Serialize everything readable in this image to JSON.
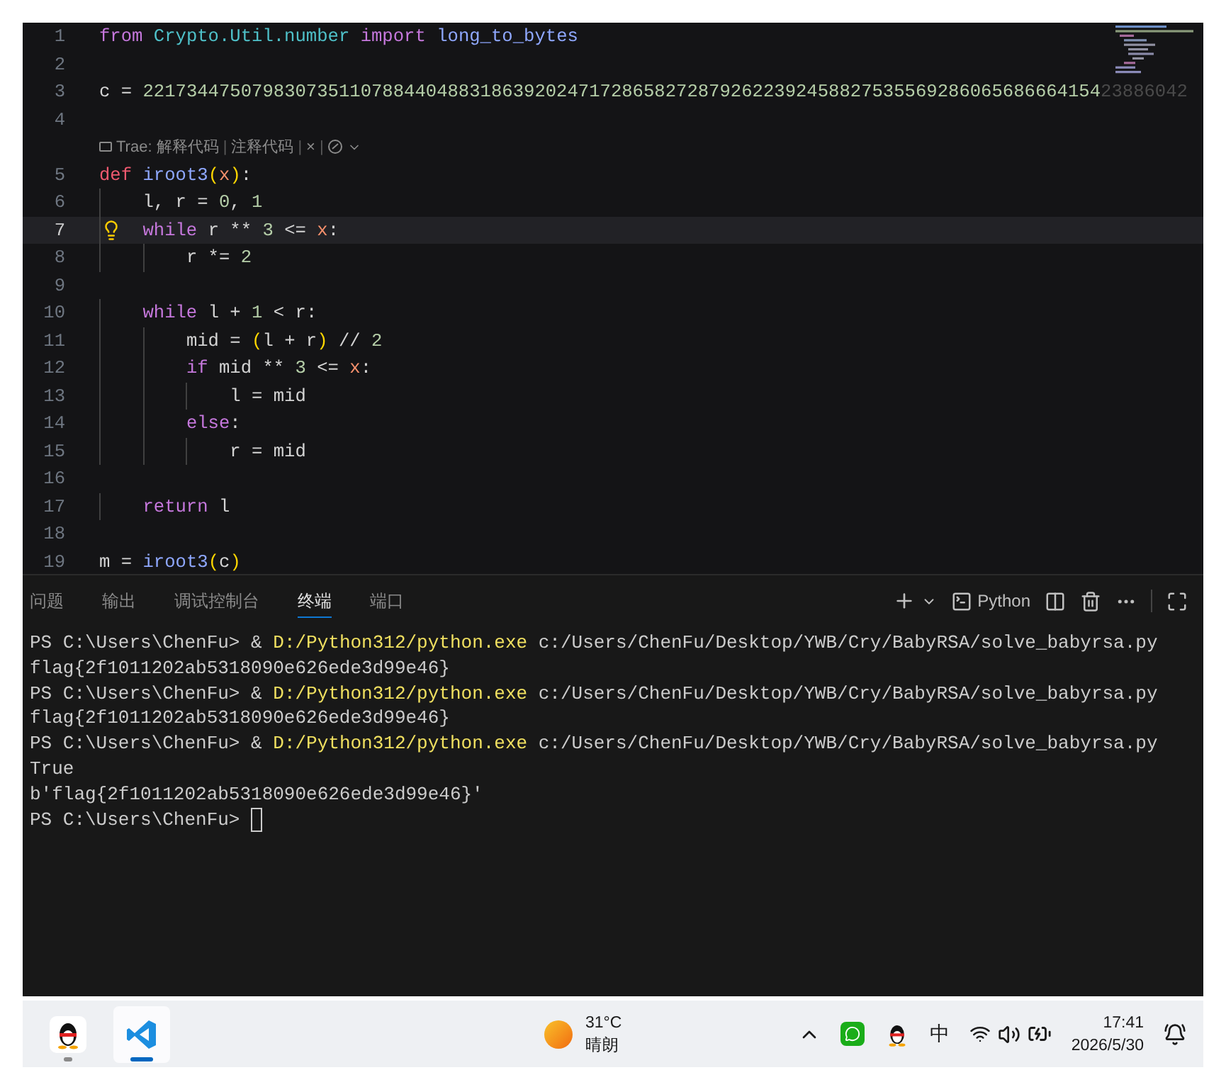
{
  "editor": {
    "lines": [
      {
        "kind": "code",
        "number": "1",
        "current": false,
        "tokens": [
          {
            "text": "from ",
            "kind": "kw"
          },
          {
            "text": "Crypto.Util.number ",
            "kind": "mod"
          },
          {
            "text": "import ",
            "kind": "kw"
          },
          {
            "text": "long_to_bytes",
            "kind": "fn"
          }
        ]
      },
      {
        "kind": "code",
        "number": "2",
        "current": false
      },
      {
        "kind": "code",
        "number": "3",
        "current": false,
        "tokens": [
          {
            "text": "c = ",
            "kind": "plain"
          },
          {
            "text": "2217344750798307351107884404883186392024717286582728792622392458827535569286065686664154",
            "kind": "num"
          },
          {
            "text": "23886042",
            "kind": "faded"
          }
        ]
      },
      {
        "kind": "code",
        "number": "4",
        "current": false
      },
      {
        "kind": "codelens",
        "segments": [
          {
            "text": "Trae: 解释代码",
            "kind": "action"
          },
          {
            "text": "|",
            "kind": "sep"
          },
          {
            "text": "注释代码",
            "kind": "action"
          },
          {
            "text": "|",
            "kind": "sep"
          },
          {
            "text": "×",
            "kind": "action"
          },
          {
            "text": "|",
            "kind": "sep"
          }
        ]
      },
      {
        "kind": "code",
        "number": "5",
        "current": false,
        "tokens": [
          {
            "text": "def ",
            "kind": "def"
          },
          {
            "text": "iroot3",
            "kind": "fn"
          },
          {
            "text": "(",
            "kind": "paren"
          },
          {
            "text": "x",
            "kind": "param"
          },
          {
            "text": ")",
            "kind": "paren"
          },
          {
            "text": ":",
            "kind": "plain"
          }
        ]
      },
      {
        "kind": "code",
        "number": "6",
        "current": false,
        "tokens": [
          {
            "text": "    l, r = ",
            "kind": "plain"
          },
          {
            "text": "0",
            "kind": "num"
          },
          {
            "text": ", ",
            "kind": "plain"
          },
          {
            "text": "1",
            "kind": "num"
          }
        ]
      },
      {
        "kind": "code",
        "number": "7",
        "current": true,
        "tokens": [
          {
            "text": "    while",
            "kind": "kw"
          },
          {
            "text": " r ** ",
            "kind": "plain"
          },
          {
            "text": "3",
            "kind": "num"
          },
          {
            "text": " <= ",
            "kind": "plain"
          },
          {
            "text": "x",
            "kind": "param"
          },
          {
            "text": ":",
            "kind": "plain"
          }
        ]
      },
      {
        "kind": "code",
        "number": "8",
        "current": false,
        "tokens": [
          {
            "text": "        r *= ",
            "kind": "plain"
          },
          {
            "text": "2",
            "kind": "num"
          }
        ]
      },
      {
        "kind": "code",
        "number": "9",
        "current": false
      },
      {
        "kind": "code",
        "number": "10",
        "current": false,
        "tokens": [
          {
            "text": "    while",
            "kind": "kw"
          },
          {
            "text": " l + ",
            "kind": "plain"
          },
          {
            "text": "1",
            "kind": "num"
          },
          {
            "text": " < r:",
            "kind": "plain"
          }
        ]
      },
      {
        "kind": "code",
        "number": "11",
        "current": false,
        "tokens": [
          {
            "text": "        mid = ",
            "kind": "plain"
          },
          {
            "text": "(",
            "kind": "paren"
          },
          {
            "text": "l + r",
            "kind": "plain"
          },
          {
            "text": ")",
            "kind": "paren"
          },
          {
            "text": " // ",
            "kind": "plain"
          },
          {
            "text": "2",
            "kind": "num"
          }
        ]
      },
      {
        "kind": "code",
        "number": "12",
        "current": false,
        "tokens": [
          {
            "text": "        if",
            "kind": "kw"
          },
          {
            "text": " mid ** ",
            "kind": "plain"
          },
          {
            "text": "3",
            "kind": "num"
          },
          {
            "text": " <= ",
            "kind": "plain"
          },
          {
            "text": "x",
            "kind": "param"
          },
          {
            "text": ":",
            "kind": "plain"
          }
        ]
      },
      {
        "kind": "code",
        "number": "13",
        "current": false,
        "tokens": [
          {
            "text": "            l = mid",
            "kind": "plain"
          }
        ]
      },
      {
        "kind": "code",
        "number": "14",
        "current": false,
        "tokens": [
          {
            "text": "        else",
            "kind": "kw"
          },
          {
            "text": ":",
            "kind": "plain"
          }
        ]
      },
      {
        "kind": "code",
        "number": "15",
        "current": false,
        "tokens": [
          {
            "text": "            r = mid",
            "kind": "plain"
          }
        ]
      },
      {
        "kind": "code",
        "number": "16",
        "current": false
      },
      {
        "kind": "code",
        "number": "17",
        "current": false,
        "tokens": [
          {
            "text": "    return",
            "kind": "kw"
          },
          {
            "text": " l",
            "kind": "plain"
          }
        ]
      },
      {
        "kind": "code",
        "number": "18",
        "current": false
      },
      {
        "kind": "code",
        "number": "19",
        "current": false,
        "tokens": [
          {
            "text": "m = ",
            "kind": "plain"
          },
          {
            "text": "iroot3",
            "kind": "fn"
          },
          {
            "text": "(",
            "kind": "paren"
          },
          {
            "text": "c",
            "kind": "plain"
          },
          {
            "text": ")",
            "kind": "paren"
          }
        ]
      }
    ]
  },
  "panel": {
    "tabs": [
      {
        "label": "问题",
        "selected": false
      },
      {
        "label": "输出",
        "selected": false
      },
      {
        "label": "调试控制台",
        "selected": false
      },
      {
        "label": "终端",
        "selected": true
      },
      {
        "label": "端口",
        "selected": false
      }
    ],
    "profile": "Python",
    "terminal": {
      "cursor": true,
      "lines": [
        {
          "segments": [
            {
              "text": "PS C:\\Users\\ChenFu> & ",
              "kind": "plain"
            },
            {
              "text": "D:/Python312/python.exe",
              "kind": "exe"
            },
            {
              "text": " c:/Users/ChenFu/Desktop/YWB/Cry/BabyRSA/solve_babyrsa.py",
              "kind": "plain"
            }
          ]
        },
        {
          "segments": [
            {
              "text": "flag{2f1011202ab5318090e626ede3d99e46}",
              "kind": "plain"
            }
          ]
        },
        {
          "segments": [
            {
              "text": "PS C:\\Users\\ChenFu> & ",
              "kind": "plain"
            },
            {
              "text": "D:/Python312/python.exe",
              "kind": "exe"
            },
            {
              "text": " c:/Users/ChenFu/Desktop/YWB/Cry/BabyRSA/solve_babyrsa.py",
              "kind": "plain"
            }
          ]
        },
        {
          "segments": [
            {
              "text": "flag{2f1011202ab5318090e626ede3d99e46}",
              "kind": "plain"
            }
          ]
        },
        {
          "segments": [
            {
              "text": "PS C:\\Users\\ChenFu> & ",
              "kind": "plain"
            },
            {
              "text": "D:/Python312/python.exe",
              "kind": "exe"
            },
            {
              "text": " c:/Users/ChenFu/Desktop/YWB/Cry/BabyRSA/solve_babyrsa.py",
              "kind": "plain"
            }
          ]
        },
        {
          "segments": [
            {
              "text": "True",
              "kind": "plain"
            }
          ]
        },
        {
          "segments": [
            {
              "text": "b'flag{2f1011202ab5318090e626ede3d99e46}'",
              "kind": "plain"
            }
          ]
        },
        {
          "segments": [
            {
              "text": "PS C:\\Users\\ChenFu> ",
              "kind": "plain"
            }
          ]
        }
      ]
    }
  },
  "taskbar": {
    "apps": [
      {
        "kind": "qq",
        "selected": false
      },
      {
        "kind": "vscode",
        "selected": true
      }
    ],
    "weather": {
      "temp": "31°C",
      "condition": "晴朗"
    },
    "ime": "中",
    "time": "17:41",
    "date": "2026/5/30"
  }
}
